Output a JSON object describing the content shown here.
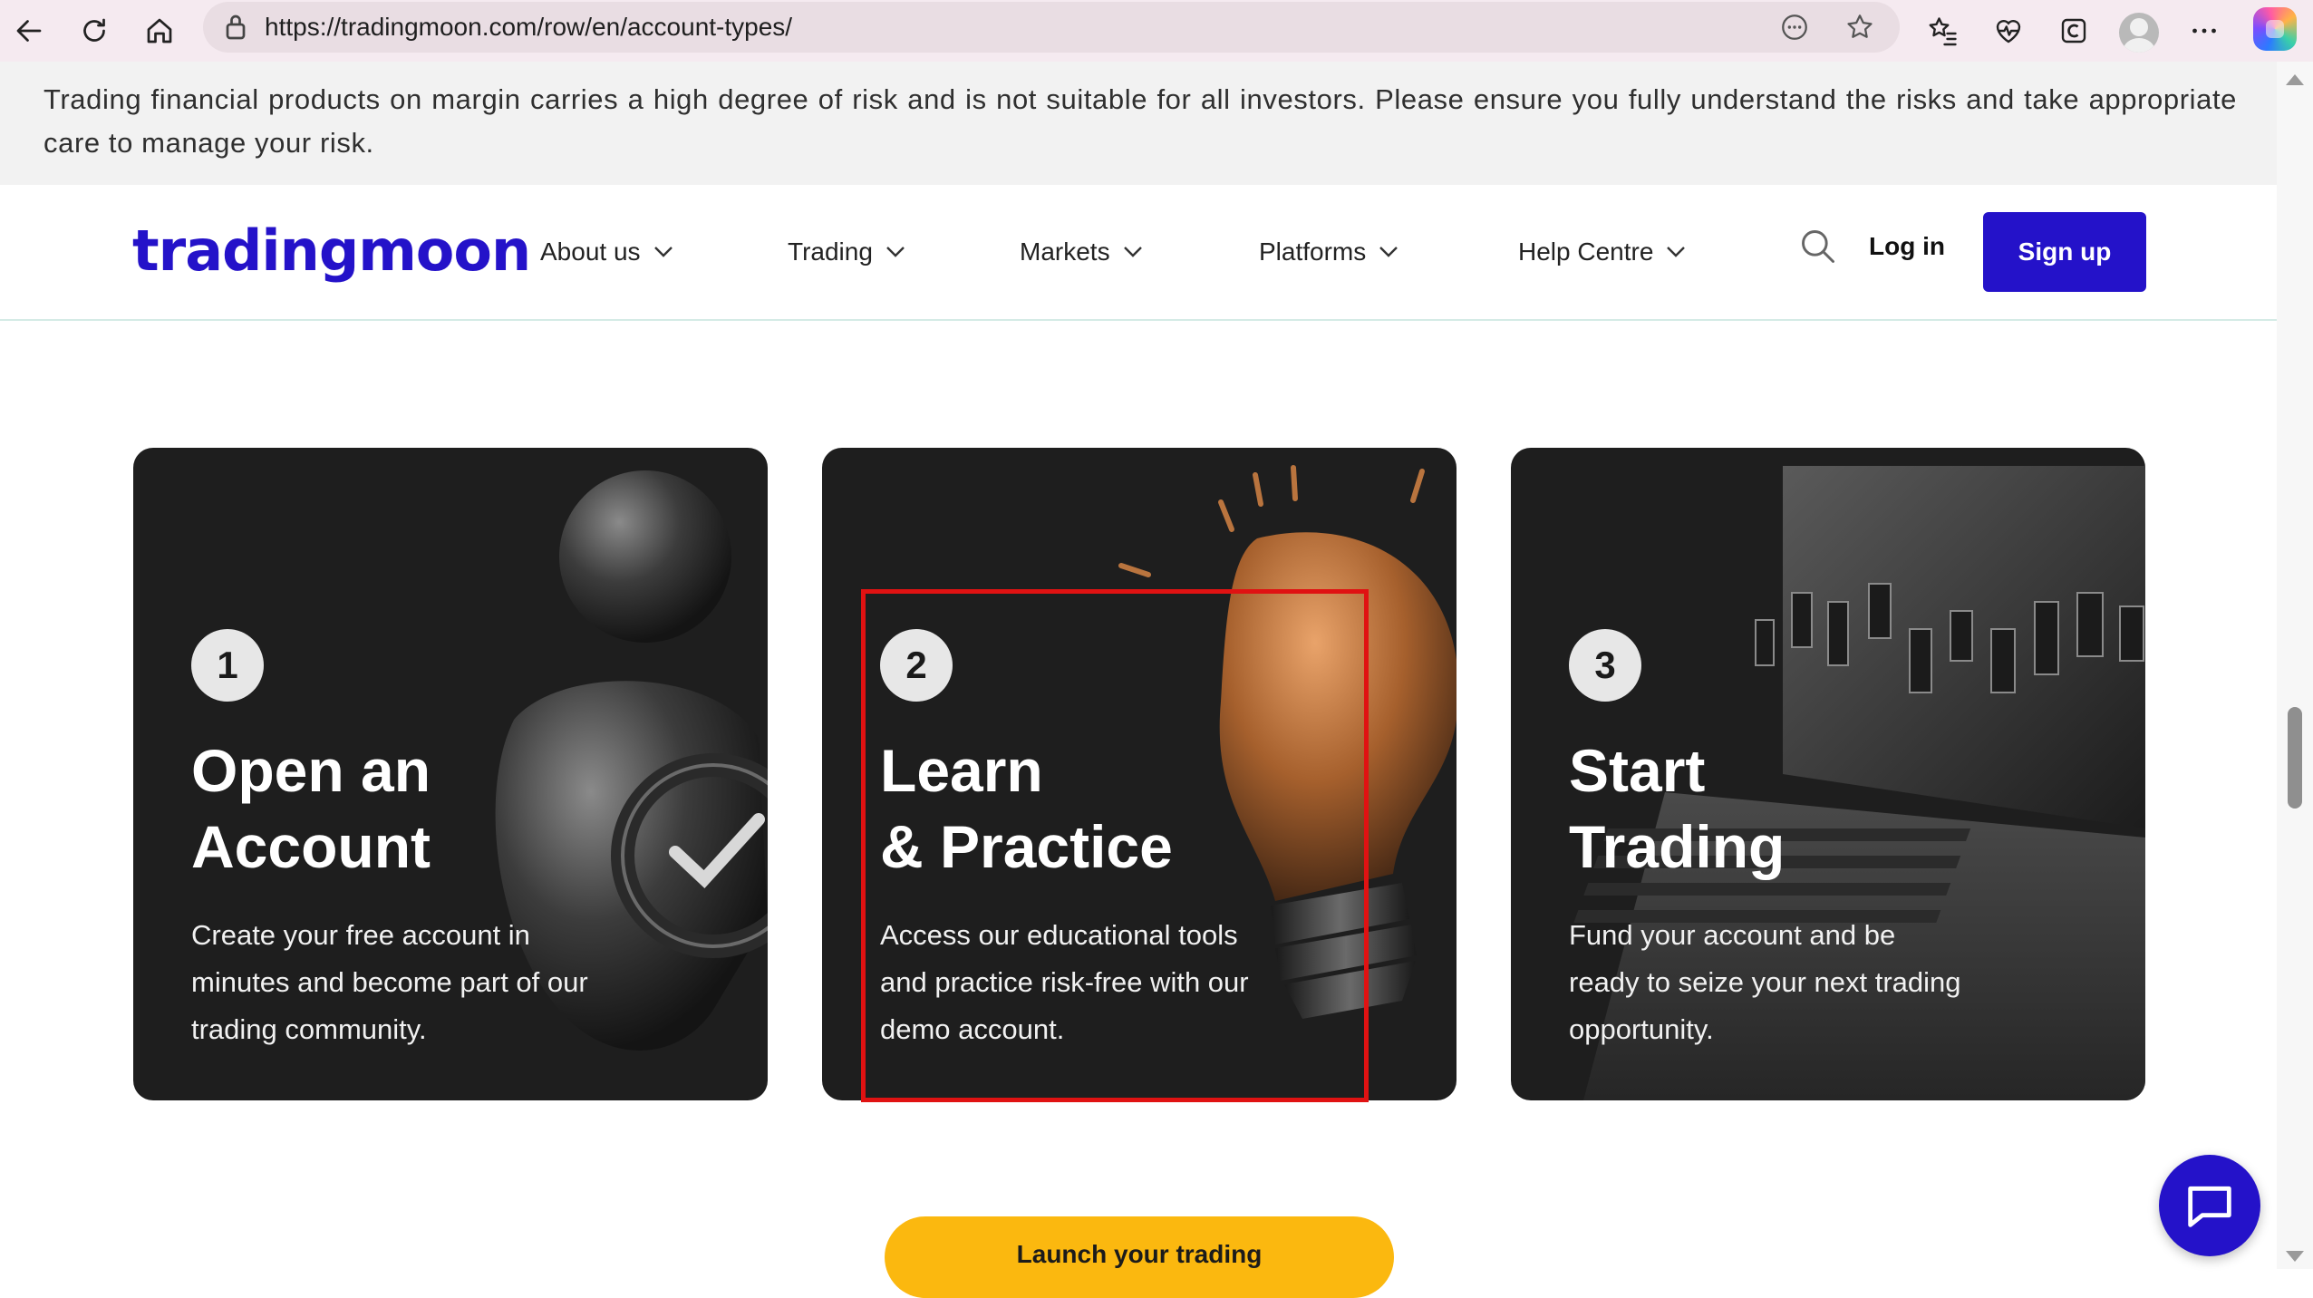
{
  "browser": {
    "url": "https://tradingmoon.com/row/en/account-types/",
    "icons": [
      "back-icon",
      "reload-icon",
      "home-icon",
      "site-info-icon",
      "reading-mode-icon",
      "favorite-star-icon",
      "favorites-icon",
      "browser-essentials-icon",
      "collections-icon",
      "profile-icon",
      "more-icon",
      "copilot-icon"
    ]
  },
  "risk_warning": {
    "text": "Trading financial products on margin carries a high degree of risk and is not suitable for all investors. Please ensure you fully understand the risks and take appropriate care to manage your risk."
  },
  "header": {
    "logo": "tradingmoon",
    "nav": [
      {
        "label": "About us"
      },
      {
        "label": "Trading"
      },
      {
        "label": "Markets"
      },
      {
        "label": "Platforms"
      },
      {
        "label": "Help Centre"
      }
    ],
    "login_label": "Log in",
    "signup_label": "Sign up",
    "accent_color": "#2412c9"
  },
  "steps": [
    {
      "number": "1",
      "title_line1": "Open an",
      "title_line2": "Account",
      "description": "Create your free account in minutes and become part of our trading community.",
      "art": "person-with-checkmark"
    },
    {
      "number": "2",
      "title_line1": "Learn",
      "title_line2": "& Practice",
      "description": "Access our educational tools and practice risk-free with our demo account.",
      "art": "light-bulb"
    },
    {
      "number": "3",
      "title_line1": "Start",
      "title_line2": "Trading",
      "description": "Fund your account and be ready to seize your next trading opportunity.",
      "art": "laptop-with-candlesticks"
    }
  ],
  "highlight_color": "#e01212",
  "cta": {
    "label": "Launch your trading",
    "color": "#fbb80f"
  },
  "chat": {
    "icon": "chat-bubble-icon"
  }
}
